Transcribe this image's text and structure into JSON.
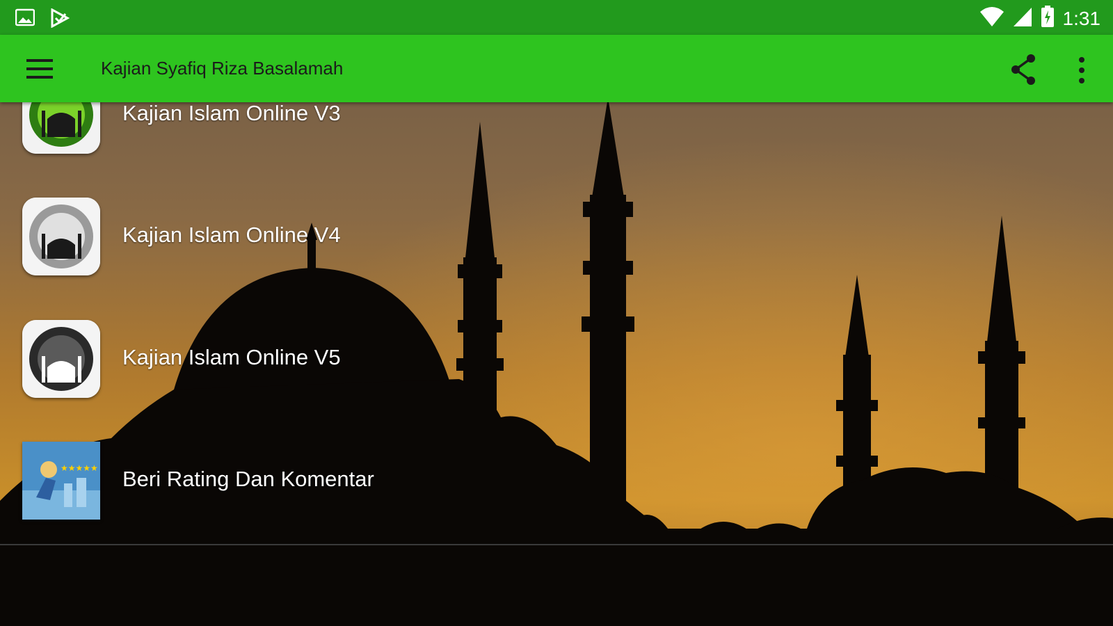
{
  "status_bar": {
    "time": "1:31",
    "left_icons": [
      "gallery-icon",
      "play-store-icon"
    ],
    "right_icons": [
      "wifi-icon",
      "signal-icon",
      "battery-icon"
    ]
  },
  "app_bar": {
    "title": "Kajian Syafiq Riza Basalamah",
    "nav_icon": "hamburger-menu-icon",
    "actions": [
      "share-icon",
      "overflow-menu-icon"
    ]
  },
  "menu_items": [
    {
      "label": "Kajian Islam Online V3",
      "icon": "mosque-green-icon"
    },
    {
      "label": "Kajian Islam Online V4",
      "icon": "mosque-grey-icon"
    },
    {
      "label": "Kajian Islam Online V5",
      "icon": "mosque-dark-icon"
    },
    {
      "label": "Beri Rating Dan Komentar",
      "icon": "rating-icon"
    }
  ],
  "colors": {
    "status_bar": "#229a1d",
    "app_bar": "#2ec41f",
    "title_text": "#1b1b1b",
    "item_text": "#ffffff"
  }
}
